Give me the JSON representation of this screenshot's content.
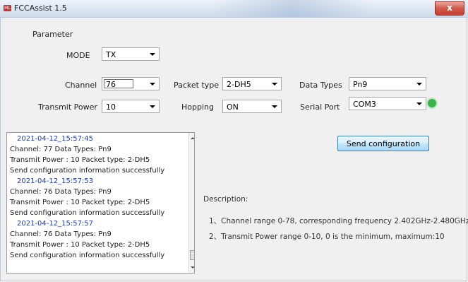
{
  "window": {
    "title": "FCCAssist 1.5",
    "icon_text": "ML",
    "close_symbol": "x"
  },
  "section_title": "Parameter",
  "mode": {
    "label": "MODE",
    "value": "TX"
  },
  "channel": {
    "label": "Channel",
    "value": "76"
  },
  "packet_type": {
    "label": "Packet type",
    "value": "2-DH5"
  },
  "data_types": {
    "label": "Data Types",
    "value": "Pn9"
  },
  "transmit_power": {
    "label": "Transmit Power",
    "value": "10"
  },
  "hopping": {
    "label": "Hopping",
    "value": "ON"
  },
  "serial_port": {
    "label": "Serial Port",
    "value": "COM3",
    "status_color": "#3ab54a"
  },
  "log": {
    "lines": [
      "2021-04-12_15:57:45",
      "Channel: 77        Data Types: Pn9",
      "Transmit Power : 10    Packet type: 2-DH5",
      "Send configuration information successfully",
      "2021-04-12_15:57:53",
      "Channel: 76        Data Types: Pn9",
      "Transmit Power : 10    Packet type: 2-DH5",
      "Send configuration information successfully",
      "2021-04-12_15:57:57",
      "Channel: 76        Data Types: Pn9",
      "Transmit Power : 10    Packet type: 2-DH5",
      "Send configuration information successfully"
    ]
  },
  "send_button": {
    "label": "Send configuration"
  },
  "description": {
    "title": "Description:",
    "line1": "1、Channel range 0-78, corresponding frequency 2.402GHz-2.480GHz",
    "line2": "2、Transmit Power  range 0-10, 0 is the minimum, maximum:10"
  }
}
